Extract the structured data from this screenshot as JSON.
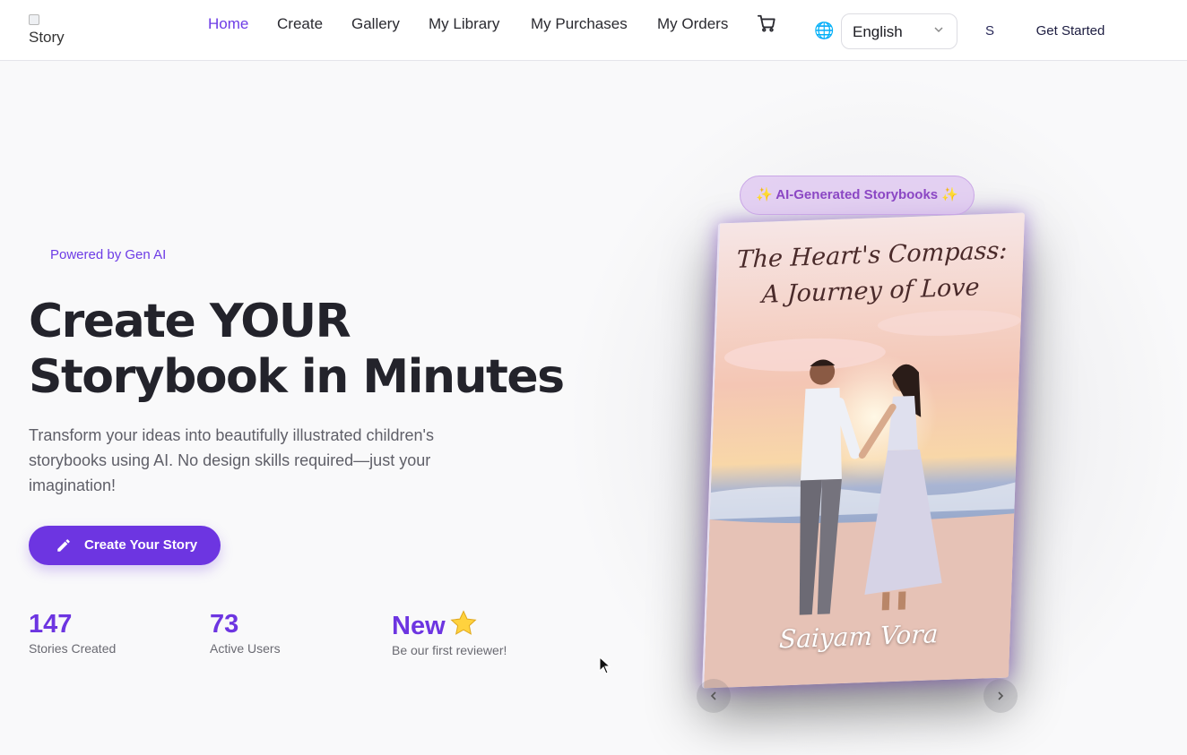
{
  "header": {
    "logo_alt": "Story",
    "nav": [
      {
        "label": "Home",
        "active": true
      },
      {
        "label": "Create",
        "active": false
      },
      {
        "label": "Gallery",
        "active": false
      },
      {
        "label": "My Library",
        "active": false
      },
      {
        "label": "My Purchases",
        "active": false
      },
      {
        "label": "My Orders",
        "active": false
      }
    ],
    "cart_icon": "cart-icon",
    "globe_icon": "globe-icon",
    "language": "English",
    "user_initial": "S",
    "get_started": "Get Started"
  },
  "hero": {
    "powered_by": "Powered by Gen AI",
    "title_line1": "Create YOUR",
    "title_line2": "Storybook in Minutes",
    "description": "Transform your ideas into beautifully illustrated children's storybooks using AI. No design skills required—just your imagination!",
    "cta_label": "Create Your Story",
    "stats": [
      {
        "value": "147",
        "label": "Stories Created"
      },
      {
        "value": "73",
        "label": "Active Users"
      },
      {
        "value": "New",
        "label": "Be our first reviewer!"
      }
    ]
  },
  "showcase": {
    "badge": "✨  AI-Generated Storybooks  ✨",
    "book_title_line1": "The Heart's Compass:",
    "book_title_line2": "A Journey of Love",
    "book_author": "Saiyam Vora"
  },
  "colors": {
    "accent": "#6d35e1",
    "badge_bg": "#dec4f0",
    "badge_text": "#8b47c4"
  }
}
